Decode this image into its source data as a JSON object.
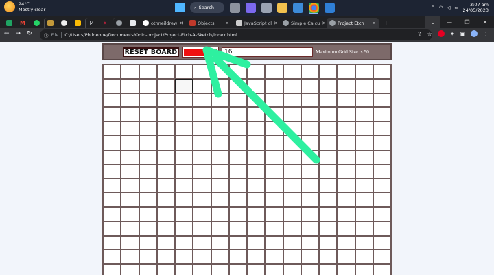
{
  "taskbar": {
    "weather": {
      "temp": "24°C",
      "desc": "Mostly clear"
    },
    "search_label": "Search",
    "clock": {
      "time": "3:07 am",
      "date": "24/05/2023"
    }
  },
  "browser": {
    "tabs": [
      {
        "label": "othneildrew",
        "fav_color": "#ffffff"
      },
      {
        "label": "Objects",
        "fav_color": "#c0392b"
      },
      {
        "label": "JavaScript cl",
        "fav_color": "#cccccc"
      },
      {
        "label": "Simple Calcu",
        "fav_color": "#9aa0a6"
      },
      {
        "label": "Project Etch",
        "fav_color": "#9aa0a6"
      }
    ],
    "address": {
      "scheme_label": "File",
      "url": "C:/Users/Phildeone/Documents/Odin-project/Project-Etch-A-Sketch/index.html"
    }
  },
  "page": {
    "reset_label": "RESET BOARD",
    "color_value": "#ee1010",
    "grid_size_value": "16",
    "max_note": "Maximum Grid Size is 50",
    "grid_cols": 16,
    "grid_rows_visible": 15,
    "hover_cell": {
      "row": 1,
      "col": 4
    }
  },
  "annotation": {
    "arrow_color": "#2ef0a0"
  }
}
